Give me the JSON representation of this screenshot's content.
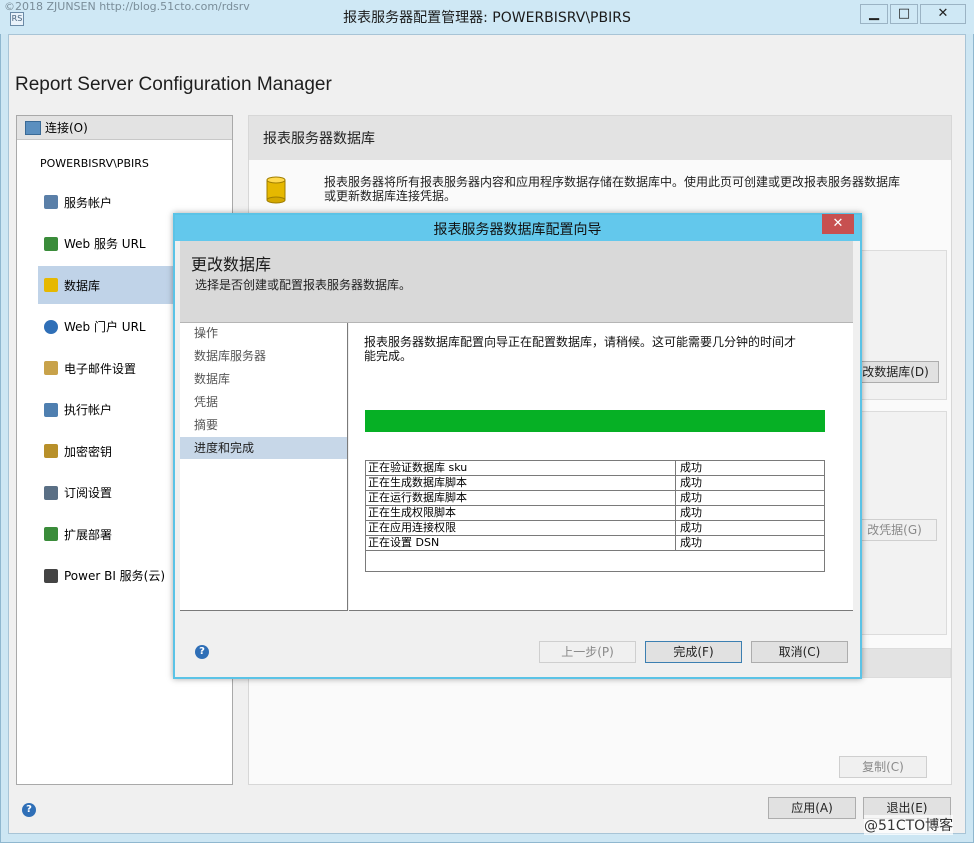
{
  "window": {
    "title": "报表服务器配置管理器: POWERBISRV\\PBIRS",
    "watermark": "©2018 ZJUNSEN http://blog.51cto.com/rdsrv",
    "minimize_glyph": "▁",
    "maximize_glyph": "□",
    "close_glyph": "✕"
  },
  "app": {
    "title": "Report Server Configuration Manager"
  },
  "nav": {
    "connect_label": "连接(O)",
    "server_name": "POWERBISRV\\PBIRS",
    "items": [
      {
        "label": "服务帐户",
        "icon": "service-account-icon",
        "selected": false
      },
      {
        "label": "Web 服务 URL",
        "icon": "web-service-icon",
        "selected": false
      },
      {
        "label": "数据库",
        "icon": "database-icon",
        "selected": true
      },
      {
        "label": "Web 门户 URL",
        "icon": "globe-icon",
        "selected": false
      },
      {
        "label": "电子邮件设置",
        "icon": "email-icon",
        "selected": false
      },
      {
        "label": "执行帐户",
        "icon": "execution-account-icon",
        "selected": false
      },
      {
        "label": "加密密钥",
        "icon": "key-icon",
        "selected": false
      },
      {
        "label": "订阅设置",
        "icon": "subscription-icon",
        "selected": false
      },
      {
        "label": "扩展部署",
        "icon": "scale-out-icon",
        "selected": false
      },
      {
        "label": "Power BI 服务(云)",
        "icon": "powerbi-icon",
        "selected": false
      }
    ]
  },
  "page": {
    "title": "报表服务器数据库",
    "description": "报表服务器将所有报表服务器内容和应用程序数据存储在数据库中。使用此页可创建或更改报表服务器数据库或更新数据库连接凭据。",
    "change_db_button": "改数据库(D)",
    "change_cred_button": "改凭据(G)",
    "copy_button": "复制(C)",
    "apply_button": "应用(A)",
    "exit_button": "退出(E)"
  },
  "dialog": {
    "title": "报表服务器数据库配置向导",
    "close_glyph": "✕",
    "heading": "更改数据库",
    "subheading": "选择是否创建或配置报表服务器数据库。",
    "steps": [
      "操作",
      "数据库服务器",
      "数据库",
      "凭据",
      "摘要",
      "进度和完成"
    ],
    "active_step": 5,
    "progress_text": "报表服务器数据库配置向导正在配置数据库，请稍候。这可能需要几分钟的时间才能完成。",
    "progress_fraction": 1.0,
    "progress_color": "#06b025",
    "status_rows": [
      {
        "task": "正在验证数据库 sku",
        "result": "成功"
      },
      {
        "task": "正在生成数据库脚本",
        "result": "成功"
      },
      {
        "task": "正在运行数据库脚本",
        "result": "成功"
      },
      {
        "task": "正在生成权限脚本",
        "result": "成功"
      },
      {
        "task": "正在应用连接权限",
        "result": "成功"
      },
      {
        "task": "正在设置 DSN",
        "result": "成功"
      }
    ],
    "back_button": "上一步(P)",
    "finish_button": "完成(F)",
    "cancel_button": "取消(C)",
    "help_glyph": "?"
  },
  "footer_watermark": "@51CTO博客"
}
